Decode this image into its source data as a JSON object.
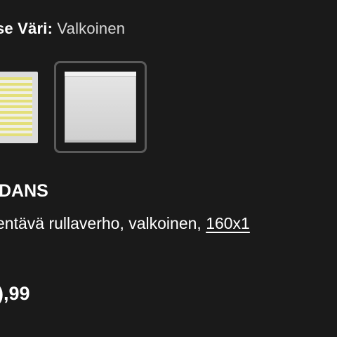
{
  "color_selector": {
    "label": "se Väri:",
    "value": "Valkoinen",
    "swatches": [
      {
        "name": "yellow-striped",
        "selected": false
      },
      {
        "name": "white",
        "selected": true
      }
    ]
  },
  "product": {
    "name": "DANS",
    "description": "entävä rullaverho, valkoinen, ",
    "size": "160x1",
    "price": "),99"
  }
}
